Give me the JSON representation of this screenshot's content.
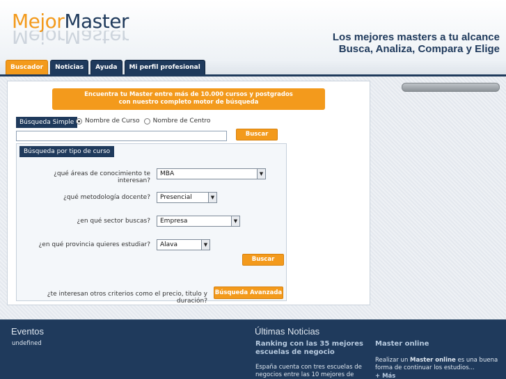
{
  "header": {
    "logo_part1": "Mejor",
    "logo_part2": "Master",
    "slogan_line1": "Los mejores masters a tu alcance",
    "slogan_line2": "Busca, Analiza, Compara y Elige"
  },
  "tabs": [
    {
      "label": "Buscador",
      "active": true
    },
    {
      "label": "Noticias",
      "active": false
    },
    {
      "label": "Ayuda",
      "active": false
    },
    {
      "label": "Mi perfil profesional",
      "active": false
    }
  ],
  "banner": {
    "line1": "Encuentra tu Master entre más de 10.000 cursos y postgrados",
    "line2": "con nuestro completo motor de búsqueda"
  },
  "simple_search": {
    "label": "Búsqueda Simple",
    "radio_course": "Nombre de Curso",
    "radio_center": "Nombre de Centro",
    "input_value": "",
    "button": "Buscar"
  },
  "type_search": {
    "label": "Búsqueda por tipo de curso",
    "q_area": "¿qué áreas de conocimiento te interesan?",
    "area_value": "MBA",
    "q_method": "¿qué metodología docente?",
    "method_value": "Presencial",
    "q_sector": "¿en qué sector buscas?",
    "sector_value": "Empresa",
    "q_province": "¿en qué provincia quieres estudiar?",
    "province_value": "Alava",
    "button": "Buscar",
    "q_other": "¿te interesan otros criterios como el precio, titulo y duración?",
    "advanced_button": "Búsqueda Avanzada"
  },
  "footer": {
    "events_title": "Eventos",
    "events_text": "undefined",
    "news_title": "Últimas Noticias",
    "news_headline": "Ranking con las 35 mejores escuelas de negocio",
    "news_text": "España cuenta con tres escuelas de negocios entre las 10 mejores de",
    "online_head": "Master online",
    "online_text_pre": "Realizar un ",
    "online_text_bold": "Master online",
    "online_text_post": " es una buena forma de continuar los estudios...",
    "more_link": "+ Más"
  },
  "colors": {
    "brand_navy": "#1f3a5c",
    "brand_orange": "#f39a1c"
  }
}
